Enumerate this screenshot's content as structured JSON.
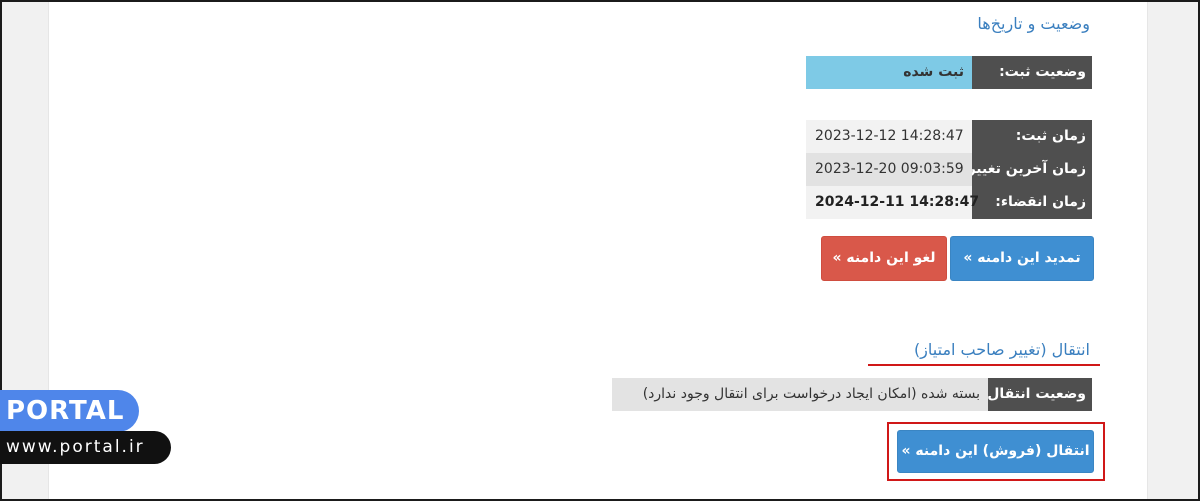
{
  "status_section": {
    "title": "وضعیت و تاریخ‌ها",
    "reg_status_label": "وضعیت ثبت:",
    "reg_status_value": "ثبت شده",
    "reg_status_color": "#7ecae6"
  },
  "dates": [
    {
      "label": "زمان ثبت:",
      "value": "2023-12-12 14:28:47"
    },
    {
      "label": "زمان آخرین تغییر:",
      "value": "2023-12-20 09:03:59"
    },
    {
      "label": "زمان انقضاء:",
      "value": "2024-12-11 14:28:47"
    }
  ],
  "actions": {
    "renew": "تمدید این دامنه »",
    "cancel": "لغو این دامنه »"
  },
  "transfer_section": {
    "title": "انتقال (تغییر صاحب امتیاز)",
    "status_label": "وضعیت انتقال:",
    "status_value": "بسته شده (امکان ایجاد درخواست برای انتقال وجود ندارد)",
    "transfer_button": "انتقال (فروش) این دامنه »"
  },
  "watermark": {
    "brand": "PORTAL",
    "url": "www.portal.ir"
  },
  "colors": {
    "accent_blue": "#3f8fd2",
    "danger_red": "#d9584a",
    "highlight_red": "#d01818"
  }
}
